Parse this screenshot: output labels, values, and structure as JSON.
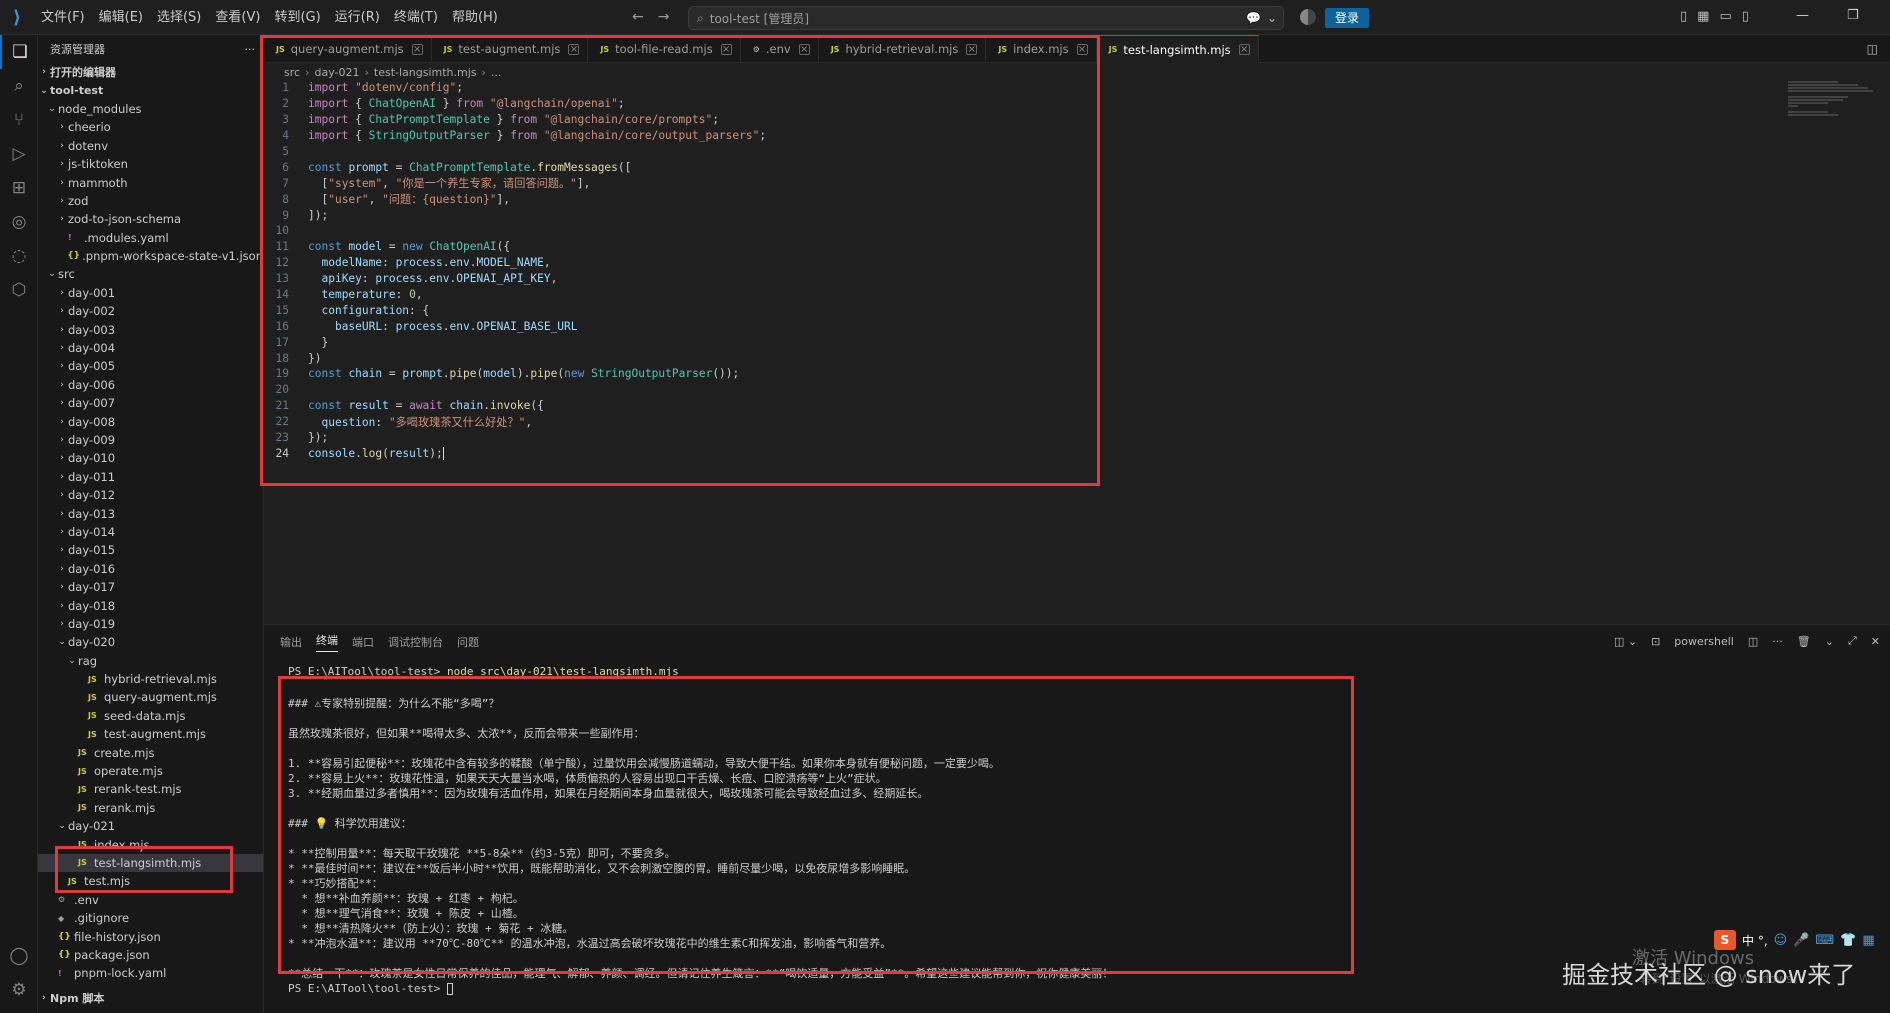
{
  "menu": [
    "文件(F)",
    "编辑(E)",
    "选择(S)",
    "查看(V)",
    "转到(G)",
    "运行(R)",
    "终端(T)",
    "帮助(H)"
  ],
  "command_center": "tool-test [管理员]",
  "login_label": "登录",
  "sidebar": {
    "title": "资源管理器",
    "open_editors": "打开的编辑器",
    "project": "tool-test",
    "items": [
      {
        "label": "node_modules",
        "type": "folder-open",
        "indent": 1
      },
      {
        "label": "cheerio",
        "type": "folder",
        "indent": 2
      },
      {
        "label": "dotenv",
        "type": "folder",
        "indent": 2
      },
      {
        "label": "js-tiktoken",
        "type": "folder",
        "indent": 2
      },
      {
        "label": "mammoth",
        "type": "folder",
        "indent": 2
      },
      {
        "label": "zod",
        "type": "folder",
        "indent": 2
      },
      {
        "label": "zod-to-json-schema",
        "type": "folder",
        "indent": 2
      },
      {
        "label": ".modules.yaml",
        "type": "yaml",
        "indent": 2
      },
      {
        "label": ".pnpm-workspace-state-v1.json",
        "type": "json",
        "indent": 2
      },
      {
        "label": "src",
        "type": "folder-open",
        "indent": 1
      },
      {
        "label": "day-001",
        "type": "folder",
        "indent": 2
      },
      {
        "label": "day-002",
        "type": "folder",
        "indent": 2
      },
      {
        "label": "day-003",
        "type": "folder",
        "indent": 2
      },
      {
        "label": "day-004",
        "type": "folder",
        "indent": 2
      },
      {
        "label": "day-005",
        "type": "folder",
        "indent": 2
      },
      {
        "label": "day-006",
        "type": "folder",
        "indent": 2
      },
      {
        "label": "day-007",
        "type": "folder",
        "indent": 2
      },
      {
        "label": "day-008",
        "type": "folder",
        "indent": 2
      },
      {
        "label": "day-009",
        "type": "folder",
        "indent": 2
      },
      {
        "label": "day-010",
        "type": "folder",
        "indent": 2
      },
      {
        "label": "day-011",
        "type": "folder",
        "indent": 2
      },
      {
        "label": "day-012",
        "type": "folder",
        "indent": 2
      },
      {
        "label": "day-013",
        "type": "folder",
        "indent": 2
      },
      {
        "label": "day-014",
        "type": "folder",
        "indent": 2
      },
      {
        "label": "day-015",
        "type": "folder",
        "indent": 2
      },
      {
        "label": "day-016",
        "type": "folder",
        "indent": 2
      },
      {
        "label": "day-017",
        "type": "folder",
        "indent": 2
      },
      {
        "label": "day-018",
        "type": "folder",
        "indent": 2
      },
      {
        "label": "day-019",
        "type": "folder",
        "indent": 2
      },
      {
        "label": "day-020",
        "type": "folder-open",
        "indent": 2
      },
      {
        "label": "rag",
        "type": "folder-open",
        "indent": 3
      },
      {
        "label": "hybrid-retrieval.mjs",
        "type": "js",
        "indent": 4
      },
      {
        "label": "query-augment.mjs",
        "type": "js",
        "indent": 4
      },
      {
        "label": "seed-data.mjs",
        "type": "js",
        "indent": 4
      },
      {
        "label": "test-augment.mjs",
        "type": "js",
        "indent": 4
      },
      {
        "label": "create.mjs",
        "type": "js",
        "indent": 3
      },
      {
        "label": "operate.mjs",
        "type": "js",
        "indent": 3
      },
      {
        "label": "rerank-test.mjs",
        "type": "js",
        "indent": 3
      },
      {
        "label": "rerank.mjs",
        "type": "js",
        "indent": 3
      },
      {
        "label": "day-021",
        "type": "folder-open",
        "indent": 2
      },
      {
        "label": "index.mjs",
        "type": "js",
        "indent": 3
      },
      {
        "label": "test-langsimth.mjs",
        "type": "js",
        "indent": 3,
        "selected": true
      },
      {
        "label": "test.mjs",
        "type": "js",
        "indent": 2
      },
      {
        "label": ".env",
        "type": "env",
        "indent": 1
      },
      {
        "label": ".gitignore",
        "type": "git",
        "indent": 1
      },
      {
        "label": "file-history.json",
        "type": "json",
        "indent": 1
      },
      {
        "label": "package.json",
        "type": "json",
        "indent": 1
      },
      {
        "label": "pnpm-lock.yaml",
        "type": "yaml",
        "indent": 1
      }
    ],
    "npm_scripts": "Npm 脚本"
  },
  "tabs": [
    {
      "label": "query-augment.mjs",
      "icon": "JS"
    },
    {
      "label": "test-augment.mjs",
      "icon": "JS"
    },
    {
      "label": "tool-file-read.mjs",
      "icon": "JS"
    },
    {
      "label": ".env",
      "icon": "⚙"
    },
    {
      "label": "hybrid-retrieval.mjs",
      "icon": "JS"
    },
    {
      "label": "index.mjs",
      "icon": "JS"
    },
    {
      "label": "test-langsimth.mjs",
      "icon": "JS",
      "active": true
    }
  ],
  "breadcrumb": [
    "src",
    "day-021",
    "test-langsimth.mjs",
    "..."
  ],
  "code_lines": [
    "import \"dotenv/config\";",
    "import { ChatOpenAI } from \"@langchain/openai\";",
    "import { ChatPromptTemplate } from \"@langchain/core/prompts\";",
    "import { StringOutputParser } from \"@langchain/core/output_parsers\";",
    "",
    "const prompt = ChatPromptTemplate.fromMessages([",
    "  [\"system\", \"你是一个养生专家，请回答问题。\"],",
    "  [\"user\", \"问题：{question}\"],",
    "]);",
    "",
    "const model = new ChatOpenAI({",
    "  modelName: process.env.MODEL_NAME,",
    "  apiKey: process.env.OPENAI_API_KEY,",
    "  temperature: 0,",
    "  configuration: {",
    "    baseURL: process.env.OPENAI_BASE_URL",
    "  }",
    "})",
    "const chain = prompt.pipe(model).pipe(new StringOutputParser());",
    "",
    "const result = await chain.invoke({",
    "  question: \"多喝玫瑰茶又什么好处？\",",
    "});",
    "console.log(result);"
  ],
  "panel_tabs": [
    "输出",
    "终端",
    "端口",
    "调试控制台",
    "问题"
  ],
  "panel_active": "终端",
  "panel_shell": "powershell",
  "terminal": {
    "prompt_cmd": "PS E:\\AITool\\tool-test> ",
    "command": "node src\\day-021\\test-langsimth.mjs",
    "lines": [
      "### ⚠专家特别提醒：为什么不能“多喝”？",
      "",
      "虽然玫瑰茶很好，但如果**喝得太多、太浓**，反而会带来一些副作用：",
      "",
      "1. **容易引起便秘**：玫瑰花中含有较多的鞣酸（单宁酸），过量饮用会减慢肠道蠕动，导致大便干结。如果你本身就有便秘问题，一定要少喝。",
      "2. **容易上火**：玫瑰花性温，如果天天大量当水喝，体质偏热的人容易出现口干舌燥、长痘、口腔溃疡等“上火”症状。",
      "3. **经期血量过多者慎用**：因为玫瑰有活血作用，如果在月经期间本身血量就很大，喝玫瑰茶可能会导致经血过多、经期延长。",
      "",
      "### 💡 科学饮用建议：",
      "",
      "* **控制用量**：每天取干玫瑰花 **5-8朵**（约3-5克）即可，不要贪多。",
      "* **最佳时间**：建议在**饭后半小时**饮用，既能帮助消化，又不会刺激空腹的胃。睡前尽量少喝，以免夜尿增多影响睡眠。",
      "* **巧妙搭配**：",
      "  * 想**补血养颜**：玫瑰 + 红枣 + 枸杞。",
      "  * 想**理气消食**：玫瑰 + 陈皮 + 山楂。",
      "  * 想**清热降火**（防上火）：玫瑰 + 菊花 + 冰糖。",
      "* **冲泡水温**：建议用 **70℃-80℃** 的温水冲泡，水温过高会破坏玫瑰花中的维生素C和挥发油，影响香气和营养。",
      "",
      "**总结一下**：玫瑰茶是女性日常保养的佳品，能理气、解郁、养颜、调经。但请记住养生箴言：**“喝饮适量，方能受益”**。希望这些建议能帮到你，祝你健康美丽！"
    ],
    "last_prompt": "PS E:\\AITool\\tool-test> "
  },
  "watermark": "掘金技术社区 @ snow来了",
  "activate_windows": "激活 Windows",
  "activate_windows_sub": "转到\"设置\"以激活 Windows。",
  "ime_text": "中 °,"
}
